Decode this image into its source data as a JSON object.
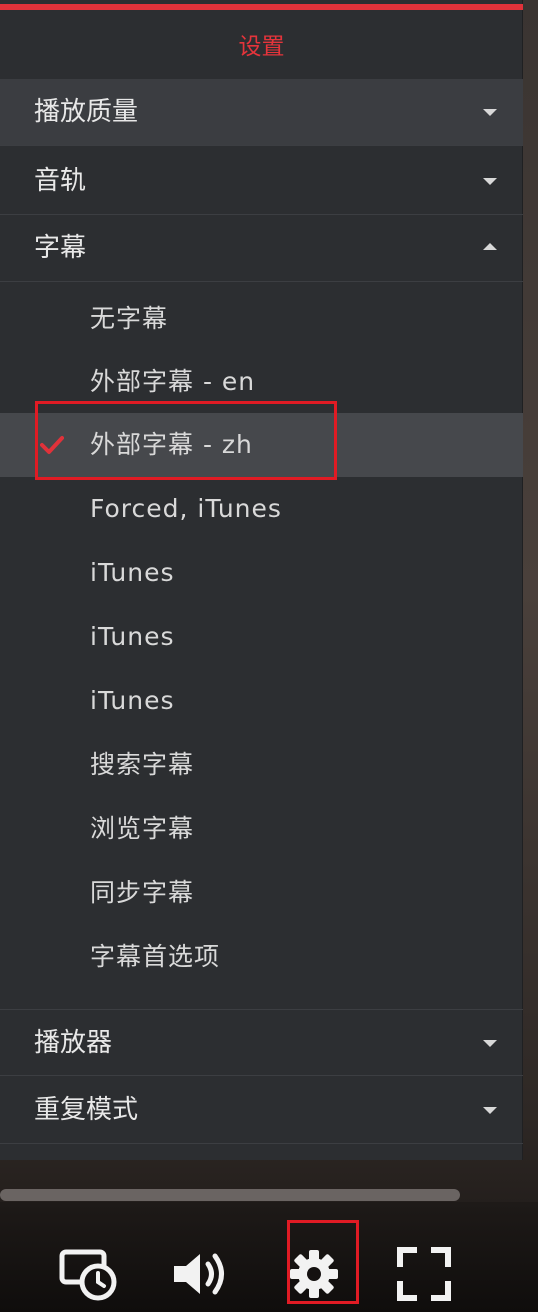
{
  "panel": {
    "title": "设置",
    "accent_color": "#e0323a"
  },
  "menu": {
    "quality_label": "播放质量",
    "audio_label": "音轨",
    "subtitles_label": "字幕",
    "player_label": "播放器",
    "repeat_label": "重复模式"
  },
  "subtitles": {
    "items": [
      "无字幕",
      "外部字幕 - en",
      "外部字幕 - zh",
      "Forced, iTunes",
      "iTunes",
      "iTunes",
      "iTunes",
      "搜索字幕",
      "浏览字幕",
      "同步字幕",
      "字幕首选项"
    ],
    "selected": "外部字幕 - zh"
  },
  "controls": {
    "icons": [
      "cast-timer-icon",
      "volume-icon",
      "settings-gear-icon",
      "fullscreen-icon"
    ]
  }
}
